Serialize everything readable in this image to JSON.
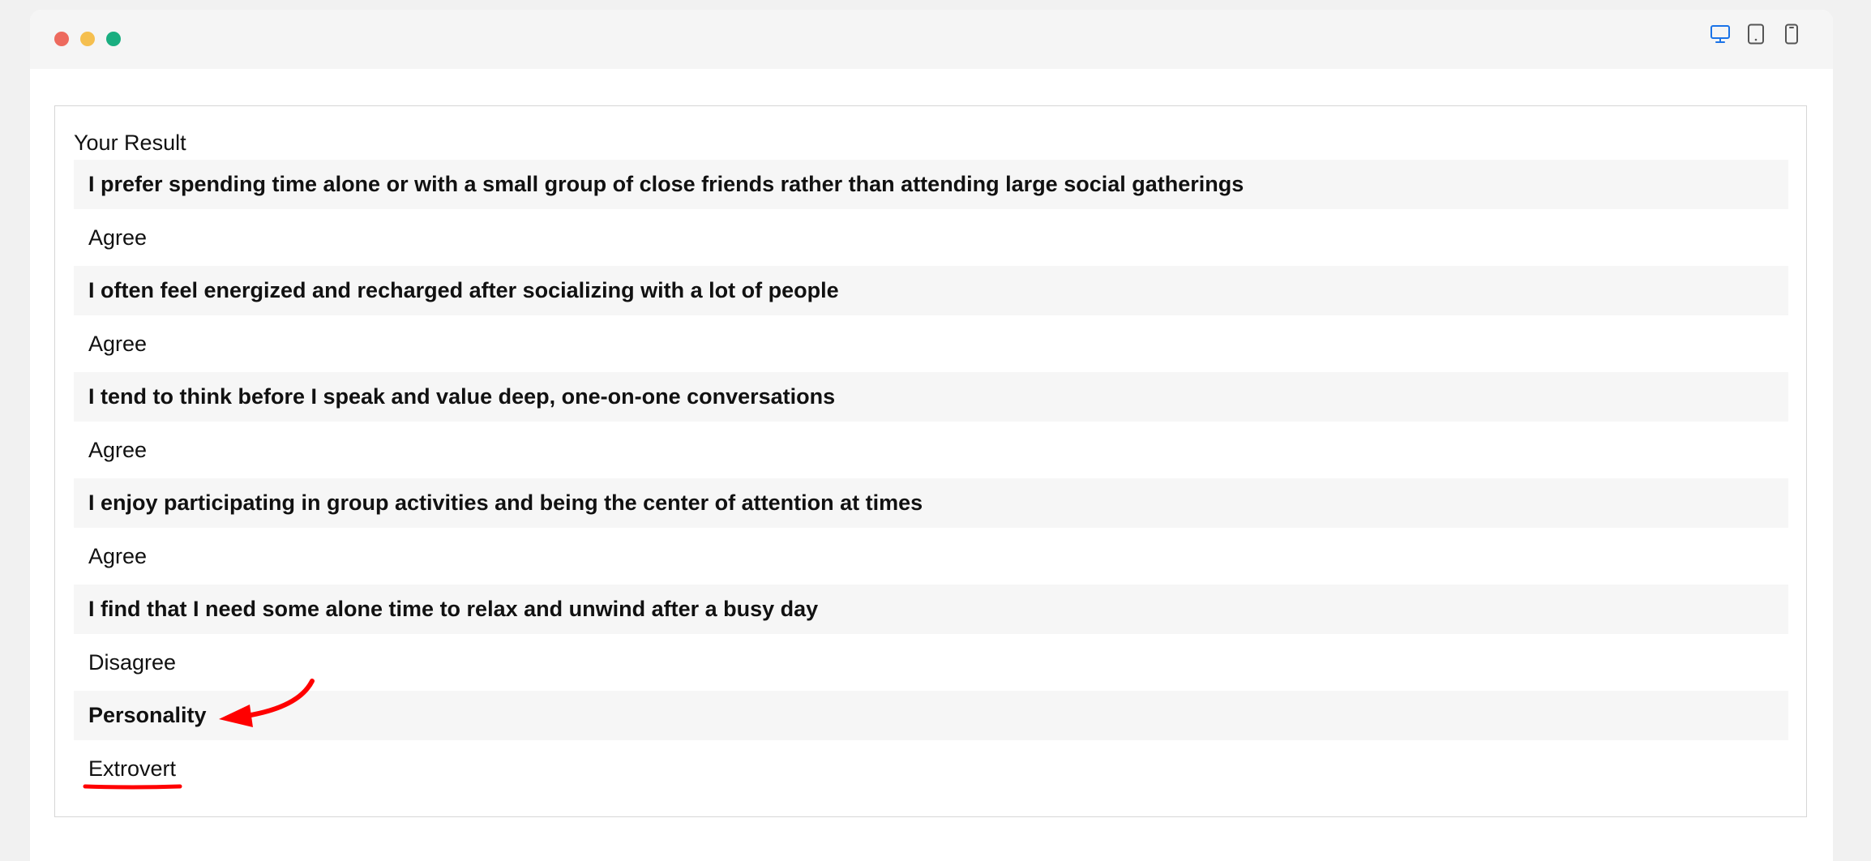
{
  "window": {
    "controls": [
      "close",
      "minimize",
      "maximize"
    ],
    "view_modes": [
      {
        "name": "desktop",
        "active": true
      },
      {
        "name": "tablet",
        "active": false
      },
      {
        "name": "mobile",
        "active": false
      }
    ],
    "accent_color": "#1a73e8"
  },
  "result": {
    "title": "Your Result",
    "items": [
      {
        "question": "I prefer spending time alone or with a small group of close friends rather than attending large social gatherings",
        "answer": "Agree"
      },
      {
        "question": "I often feel energized and recharged after socializing with a lot of people",
        "answer": "Agree"
      },
      {
        "question": "I tend to think before I speak and value deep, one-on-one conversations",
        "answer": "Agree"
      },
      {
        "question": "I enjoy participating in group activities and being the center of attention at times",
        "answer": "Agree"
      },
      {
        "question": "I find that I need some alone time to relax and unwind after a busy day",
        "answer": "Disagree"
      }
    ],
    "personality_label": "Personality",
    "personality_value": "Extrovert"
  },
  "annotations": {
    "color": "#ff0000",
    "arrow_target": "personality-label",
    "underline_target": "personality-value"
  }
}
